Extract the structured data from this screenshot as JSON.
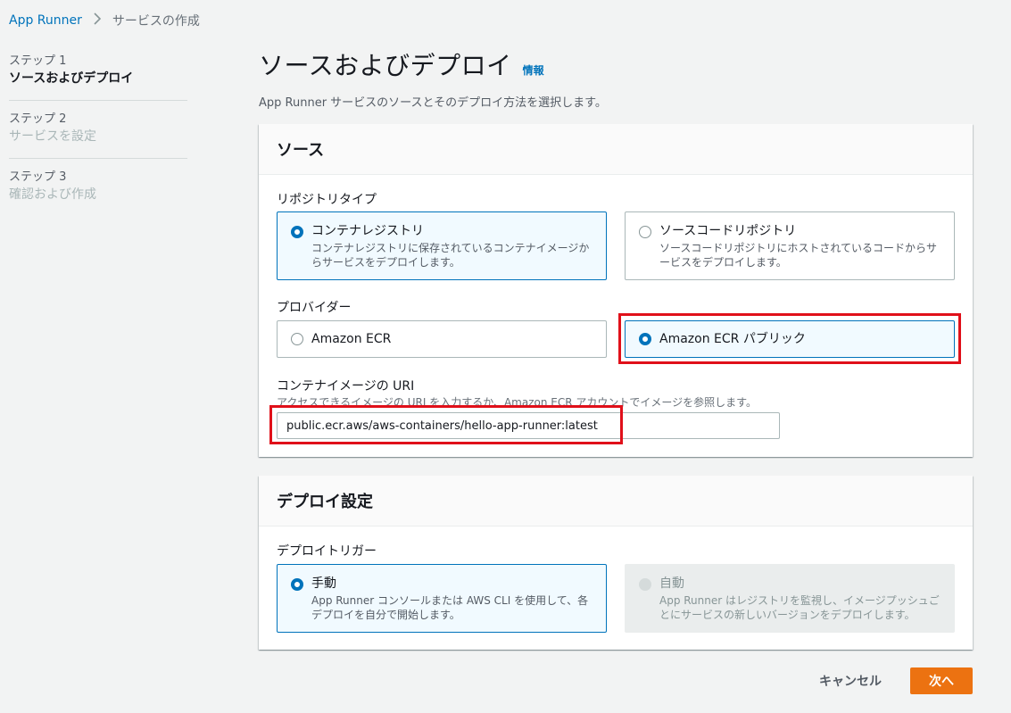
{
  "breadcrumb": {
    "root": "App Runner",
    "current": "サービスの作成"
  },
  "steps": [
    {
      "num": "ステップ 1",
      "name": "ソースおよびデプロイ",
      "active": true
    },
    {
      "num": "ステップ 2",
      "name": "サービスを設定",
      "active": false
    },
    {
      "num": "ステップ 3",
      "name": "確認および作成",
      "active": false
    }
  ],
  "page": {
    "title": "ソースおよびデプロイ",
    "info": "情報",
    "description": "App Runner サービスのソースとそのデプロイ方法を選択します。"
  },
  "source_panel": {
    "header": "ソース",
    "repo_type_label": "リポジトリタイプ",
    "repo_types": [
      {
        "title": "コンテナレジストリ",
        "desc": "コンテナレジストリに保存されているコンテナイメージからサービスをデプロイします。",
        "selected": true
      },
      {
        "title": "ソースコードリポジトリ",
        "desc": "ソースコードリポジトリにホストされているコードからサービスをデプロイします。",
        "selected": false
      }
    ],
    "provider_label": "プロバイダー",
    "providers": [
      {
        "title": "Amazon ECR",
        "selected": false
      },
      {
        "title": "Amazon ECR パブリック",
        "selected": true
      }
    ],
    "uri_label": "コンテナイメージの URI",
    "uri_desc": "アクセスできるイメージの URI を入力するか、Amazon ECR アカウントでイメージを参照します。",
    "uri_value": "public.ecr.aws/aws-containers/hello-app-runner:latest"
  },
  "deploy_panel": {
    "header": "デプロイ設定",
    "trigger_label": "デプロイトリガー",
    "triggers": [
      {
        "title": "手動",
        "desc": "App Runner コンソールまたは AWS CLI を使用して、各デプロイを自分で開始します。",
        "selected": true,
        "disabled": false
      },
      {
        "title": "自動",
        "desc": "App Runner はレジストリを監視し、イメージプッシュごとにサービスの新しいバージョンをデプロイします。",
        "selected": false,
        "disabled": true
      }
    ]
  },
  "buttons": {
    "cancel": "キャンセル",
    "next": "次へ"
  },
  "colors": {
    "accent": "#0073bb",
    "primary_button": "#ec7211",
    "highlight": "#e0101a"
  }
}
